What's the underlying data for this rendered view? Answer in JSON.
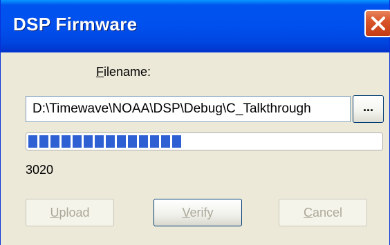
{
  "window": {
    "title": "DSP Firmware"
  },
  "filename_label": {
    "accel": "F",
    "rest": "ilename:"
  },
  "file_path": {
    "value": "D:\\Timewave\\NOAA\\DSP\\Debug\\C_Talkthrough"
  },
  "browse_button": {
    "label": "..."
  },
  "progress": {
    "fraction": 0.43,
    "segments": 14
  },
  "status": {
    "count": "3020"
  },
  "buttons": {
    "upload": {
      "accel": "U",
      "rest": "pload"
    },
    "verify": {
      "accel": "V",
      "rest": "erify"
    },
    "cancel": {
      "accel": "C",
      "rest": "ancel"
    }
  },
  "colors": {
    "titlebar": "#0050ee",
    "close_button": "#d9552a",
    "progress_fill": "#2e5fd3",
    "dialog_face": "#ece9d8"
  },
  "icons": {
    "close": "close-icon"
  }
}
